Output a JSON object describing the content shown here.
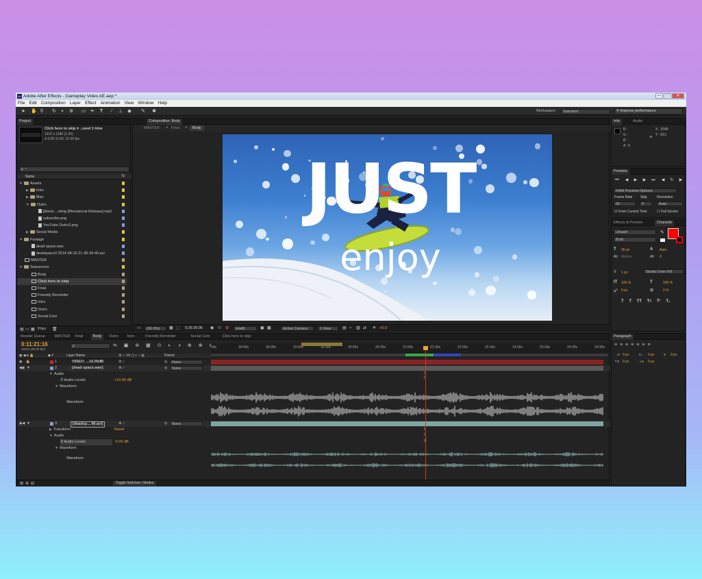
{
  "app": {
    "title": "Adobe After Effects - Gameplay Video AE.aep *",
    "logo": "Ae",
    "win_min": "—",
    "win_max": "□",
    "win_close": "✕"
  },
  "menu": [
    "File",
    "Edit",
    "Composition",
    "Layer",
    "Effect",
    "Animation",
    "View",
    "Window",
    "Help"
  ],
  "toolbar": {
    "workspace_label": "Workspace:",
    "workspace_value": "Standard",
    "search_value": "Improve performance"
  },
  "project": {
    "tab": "Project",
    "item_title": "Click here to skip ▾ , used 1 time",
    "item_dims": "1910 x 1180 (1.00)",
    "item_duration": "Δ 0:00:11:00, 15.00 fps",
    "search_placeholder": "ρ ~",
    "col_name": "Name",
    "col_type": "Ty",
    "bpc": "8 bpc",
    "tree": [
      {
        "label": "Assets",
        "depth": 0,
        "kind": "folder",
        "open": true,
        "color": "#e6c63a"
      },
      {
        "label": "Intro",
        "depth": 1,
        "kind": "folder",
        "open": false,
        "color": "#e6c63a"
      },
      {
        "label": "Misc",
        "depth": 1,
        "kind": "folder",
        "open": false,
        "color": "#e6c63a"
      },
      {
        "label": "Outro",
        "depth": 1,
        "kind": "folder",
        "open": true,
        "color": "#e6c63a"
      },
      {
        "label": "[Electr....cking [Monstercat Release].mp3",
        "depth": 2,
        "kind": "file",
        "color": "#8a9ad6"
      },
      {
        "label": "subscribe.png",
        "depth": 2,
        "kind": "file",
        "color": "#8a9ad6"
      },
      {
        "label": "YouTube Outro2.png",
        "depth": 2,
        "kind": "file",
        "color": "#8a9ad6"
      },
      {
        "label": "Social Media",
        "depth": 1,
        "kind": "folder",
        "open": false,
        "color": "#e6c63a"
      },
      {
        "label": "Footage",
        "depth": 0,
        "kind": "folder",
        "open": true,
        "color": "#e6c63a"
      },
      {
        "label": "dead space.wav",
        "depth": 1,
        "kind": "file",
        "color": "#8a9ad6"
      },
      {
        "label": "deadspace3 2014-08-16 21-38-39-49.avi",
        "depth": 1,
        "kind": "file",
        "color": "#8a9ad6"
      },
      {
        "label": "MASTER",
        "depth": 0,
        "kind": "comp",
        "color": "#b6a37c"
      },
      {
        "label": "Sequences",
        "depth": 0,
        "kind": "folder",
        "open": true,
        "color": "#e6c63a"
      },
      {
        "label": "Body",
        "depth": 1,
        "kind": "comp",
        "color": "#b6a37c"
      },
      {
        "label": "Click here to skip",
        "depth": 1,
        "kind": "comp",
        "color": "#b6a37c",
        "selected": true
      },
      {
        "label": "Final",
        "depth": 1,
        "kind": "comp",
        "color": "#b6a37c"
      },
      {
        "label": "Friendly Reminder",
        "depth": 1,
        "kind": "comp",
        "color": "#b6a37c"
      },
      {
        "label": "Intro",
        "depth": 1,
        "kind": "comp",
        "color": "#b6a37c"
      },
      {
        "label": "Outro",
        "depth": 1,
        "kind": "comp",
        "color": "#b6a37c"
      },
      {
        "label": "Social Core",
        "depth": 1,
        "kind": "comp",
        "color": "#b6a37c"
      }
    ]
  },
  "composition": {
    "tab": "Composition: Body",
    "breadcrumbs": [
      "MASTER",
      "Final",
      "Body"
    ],
    "main_text": "JUST",
    "sub_text": "enjoy",
    "zoom": "(66.9%)",
    "timecode": "0;26:26;06",
    "resolution": "(Half)",
    "camera": "Active Camera",
    "views": "1 View",
    "exposure": "+0.0"
  },
  "info": {
    "tab_info": "Info",
    "tab_audio": "Audio",
    "r": "R :",
    "g": "G :",
    "b": "B :",
    "a": "A : 0",
    "x": "X : 2049",
    "y": "Y : 813"
  },
  "preview": {
    "tab": "Preview",
    "ram_options": "RAM Preview Options",
    "frame_rate_label": "Frame Rate",
    "skip_label": "Skip",
    "resolution_label": "Resolution",
    "frame_rate": "55",
    "skip": "0",
    "resolution": "Auto",
    "from_current": "From Current Time",
    "full_screen": "Full Screen"
  },
  "character": {
    "tab_effects": "Effects & Presets",
    "tab_character": "Characte",
    "font": "Utsaah",
    "style": "Bold",
    "size": "36 px",
    "leading": "Auto",
    "kerning": "Metrics",
    "tracking": "0",
    "stroke": "1 px",
    "stroke_mode": "Stroke Over Fill",
    "vscale": "100 %",
    "hscale": "100 %",
    "baseline": "0 px",
    "tsume": "0 %",
    "fill_color": "#ff0000",
    "styles": [
      "T",
      "T",
      "TT",
      "Tт",
      "T¹",
      "T₁"
    ]
  },
  "paragraph": {
    "tab": "Paragraph",
    "v1": "0 px",
    "v2": "0 px",
    "v3": "0 px",
    "v4": "0 px",
    "v5": "0 px"
  },
  "timeline": {
    "tabs": [
      "Render Queue",
      "MASTER",
      "Final",
      "Body",
      "Outro",
      "Intro",
      "Friendly Reminder",
      "Social Core",
      "Click here to skip"
    ],
    "active_tab": "Body",
    "timecode": "0:11:21:16",
    "frame_info": "32311 (25.00 fps)",
    "col_layer_name": "Layer Name",
    "col_parent": "Parent",
    "ticks": [
      "00s",
      "18:00s",
      "18:30s",
      "19:00s",
      "19:30s",
      "20:00s",
      "20:30s",
      "21:00s",
      "21:30s",
      "22:00s",
      "22:30s",
      "23:00s",
      "23:30s",
      "24:00s",
      "24:30s"
    ],
    "layers": [
      {
        "num": "1",
        "name": "VIDEO: ...10.00dB",
        "parent": "None",
        "color": "#d02828"
      },
      {
        "num": "2",
        "name": "[dead space.wav]",
        "parent": "None",
        "color": "#8a9ad6"
      },
      {
        "num": "3",
        "name": "[deadsp....49.avi]",
        "parent": "None",
        "color": "#8a9ad6"
      }
    ],
    "audio_label": "Audio",
    "audio_levels_label": "Audio Levels",
    "audio_levels_1": "+10.00 dB",
    "audio_levels_2": "-5.00 dB",
    "waveform_label": "Waveform",
    "transform_label": "Transform",
    "reset_label": "Reset",
    "toggle_label": "Toggle Switches / Modes"
  }
}
